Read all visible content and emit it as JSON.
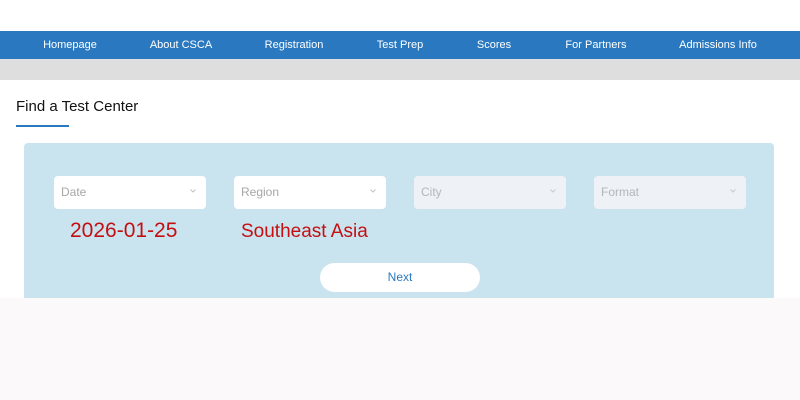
{
  "nav": {
    "items": [
      {
        "label": "Homepage"
      },
      {
        "label": "About CSCA"
      },
      {
        "label": "Registration"
      },
      {
        "label": "Test Prep"
      },
      {
        "label": "Scores"
      },
      {
        "label": "For Partners"
      },
      {
        "label": "Admissions Info"
      }
    ]
  },
  "page": {
    "title": "Find a Test Center"
  },
  "filters": {
    "date": {
      "placeholder": "Date",
      "enabled": true
    },
    "region": {
      "placeholder": "Region",
      "enabled": true
    },
    "city": {
      "placeholder": "City",
      "enabled": false
    },
    "format": {
      "placeholder": "Format",
      "enabled": false
    }
  },
  "annotations": {
    "date_value": "2026-01-25",
    "region_value": "Southeast Asia"
  },
  "actions": {
    "next_label": "Next"
  },
  "colors": {
    "nav_background": "#2a79c0",
    "panel_background": "#c9e4ef",
    "annotation_red": "#c40f12",
    "link_blue": "#2a79c0"
  },
  "icons": {
    "select_arrow": "chevron-down-icon"
  }
}
